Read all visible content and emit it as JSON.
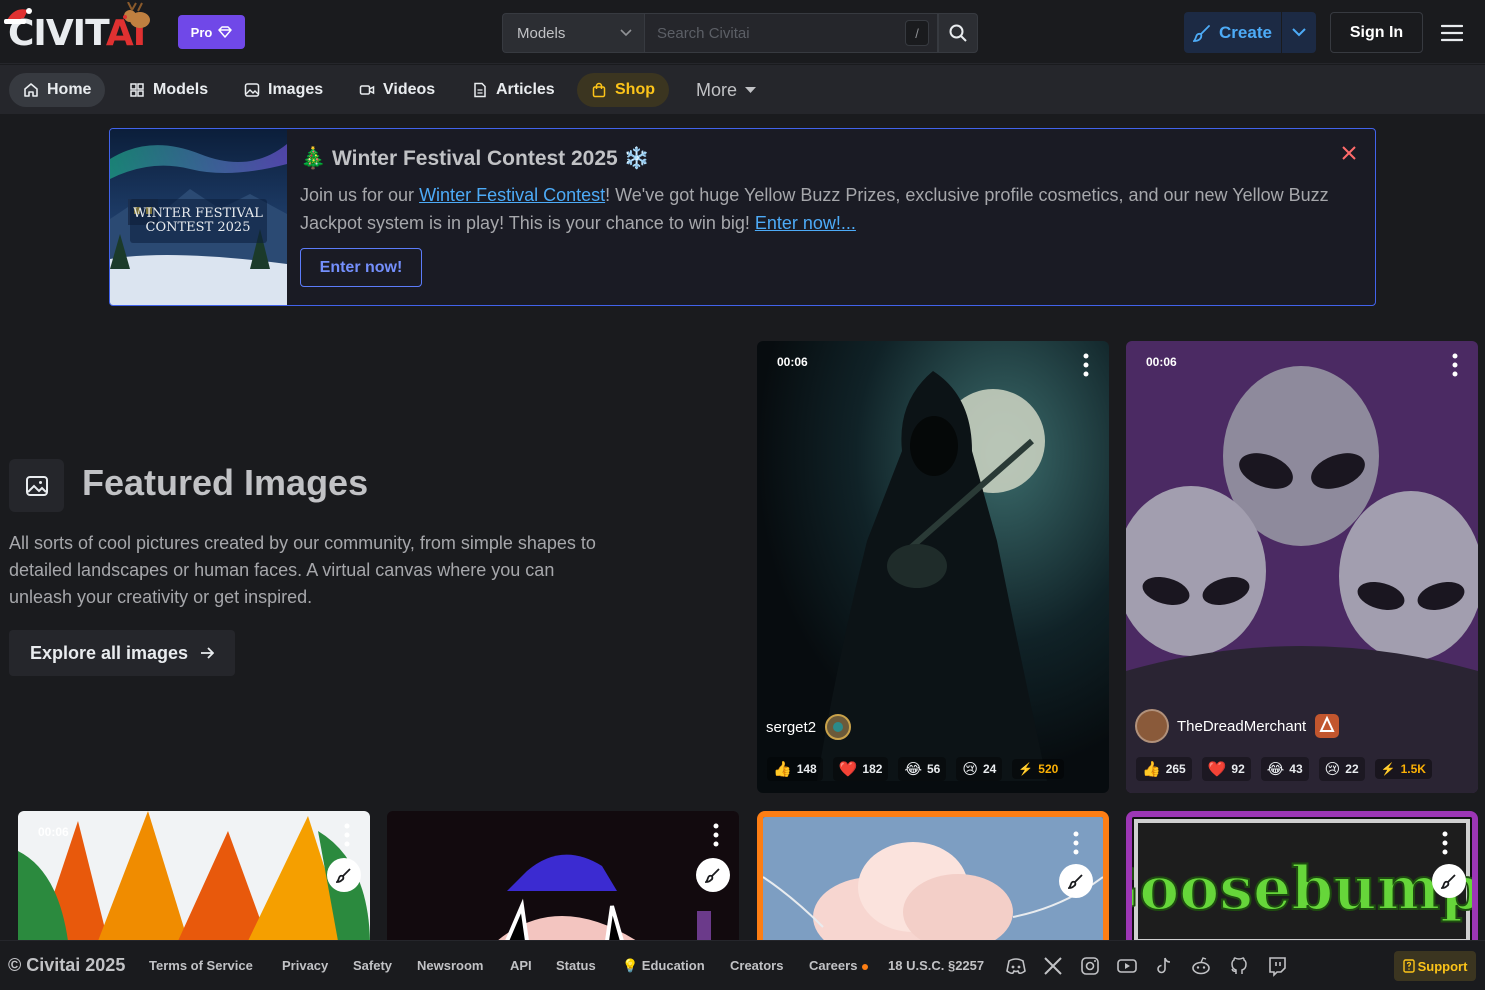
{
  "brand": {
    "logo_main": "CIVIT",
    "logo_accent": "AI",
    "pro_label": "Pro"
  },
  "search": {
    "scope": "Models",
    "placeholder": "Search Civitai",
    "shortcut": "/"
  },
  "header": {
    "create_label": "Create",
    "signin_label": "Sign In"
  },
  "nav": {
    "home": "Home",
    "models": "Models",
    "images": "Images",
    "videos": "Videos",
    "articles": "Articles",
    "shop": "Shop",
    "more": "More"
  },
  "banner": {
    "title": "🎄 Winter Festival Contest 2025 ❄️",
    "image_caption_1": "WINTER FESTIVAL",
    "image_caption_2": "CONTEST 2025",
    "body_pre": "Join us for our ",
    "body_link": "Winter Festival Contest",
    "body_mid": "! We've got huge Yellow Buzz Prizes, exclusive profile cosmetics, and our new Yellow Buzz Jackpot system is in play! This is your chance to win big! ",
    "body_link2": "Enter now!...",
    "cta": "Enter now!"
  },
  "featured": {
    "title": "Featured Images",
    "description": "All sorts of cool pictures created by our community, from simple shapes to detailed landscapes or human faces. A virtual canvas where you can unleash your creativity or get inspired.",
    "explore_label": "Explore all images"
  },
  "cards": [
    {
      "duration": "00:06",
      "author": "serget2",
      "likes": "148",
      "hearts": "182",
      "laughs": "56",
      "cries": "24",
      "buzz": "520"
    },
    {
      "duration": "00:06",
      "author": "TheDreadMerchant",
      "likes": "265",
      "hearts": "92",
      "laughs": "43",
      "cries": "22",
      "buzz": "1.5K"
    },
    {
      "duration": "00:06"
    },
    {
      "duration": ""
    },
    {
      "duration": "",
      "border_color": "#fd7e14"
    },
    {
      "title_text": "Goosebumps",
      "border_color": "#9c36b5"
    }
  ],
  "footer": {
    "copyright": "© Civitai 2025",
    "links": [
      "Terms of Service",
      "Privacy",
      "Safety",
      "Newsroom",
      "API",
      "Status",
      "💡 Education",
      "Creators",
      "Careers",
      "18 U.S.C. §2257"
    ],
    "support": "Support"
  },
  "colors": {
    "accent_blue": "#4dabf7",
    "pro_purple": "#7048e8",
    "shop_yellow": "#fcc419",
    "banner_border": "#4263eb"
  }
}
